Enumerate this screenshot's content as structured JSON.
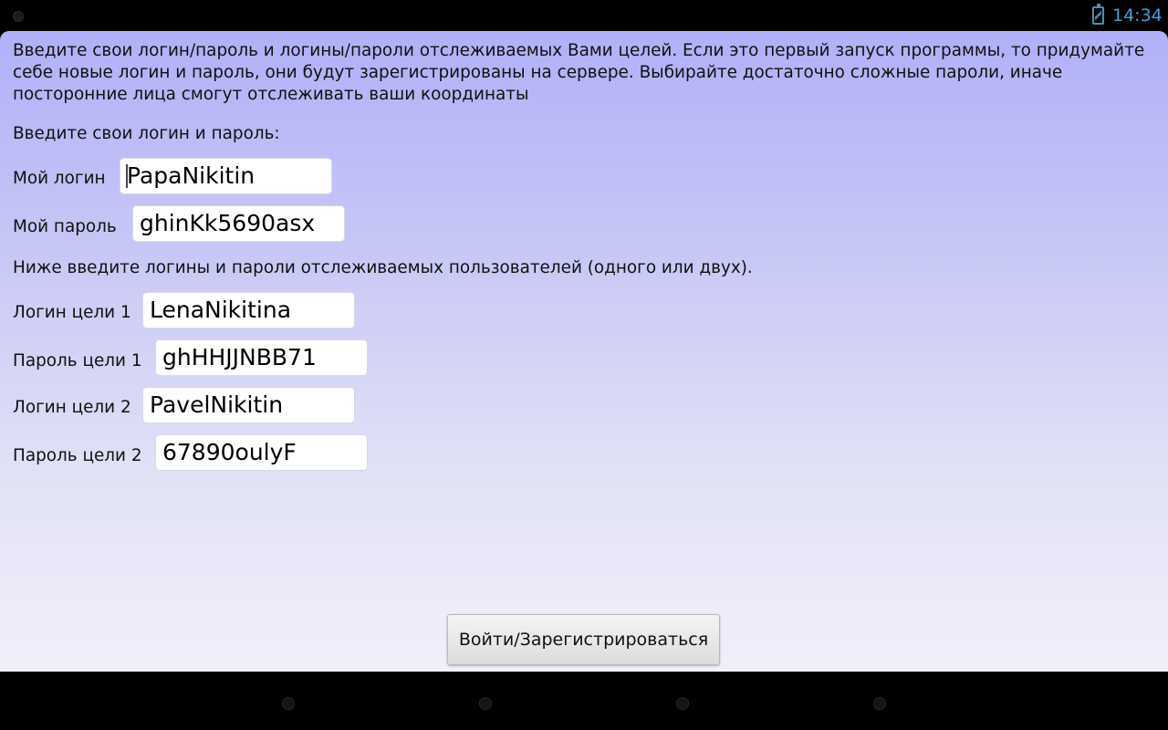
{
  "status_bar": {
    "time": "14:34"
  },
  "form": {
    "intro": "Введите свои логин/пароль и логины/пароли отслеживаемых Вами целей. Если это первый запуск программы, то придумайте себе новые логин и пароль, они будут зарегистрированы на сервере. Выбирайте достаточно сложные пароли, иначе посторонние лица смогут отслеживать ваши координаты",
    "own_heading": "Введите свои логин и пароль:",
    "my_login_label": "Мой логин",
    "my_login_value": "PapaNikitin",
    "my_password_label": "Мой пароль",
    "my_password_value": "ghinKk5690asx",
    "targets_heading": "Ниже введите логины и пароли отслеживаемых пользователей (одного или двух).",
    "target1_login_label": "Логин цели 1",
    "target1_login_value": "LenaNikitina",
    "target1_password_label": "Пароль цели 1",
    "target1_password_value": "ghHHJJNBB71",
    "target2_login_label": "Логин цели 2",
    "target2_login_value": "PavelNikitin",
    "target2_password_label": "Пароль цели 2",
    "target2_password_value": "67890oulyF",
    "submit_label": "Войти/Зарегистрироваться"
  }
}
